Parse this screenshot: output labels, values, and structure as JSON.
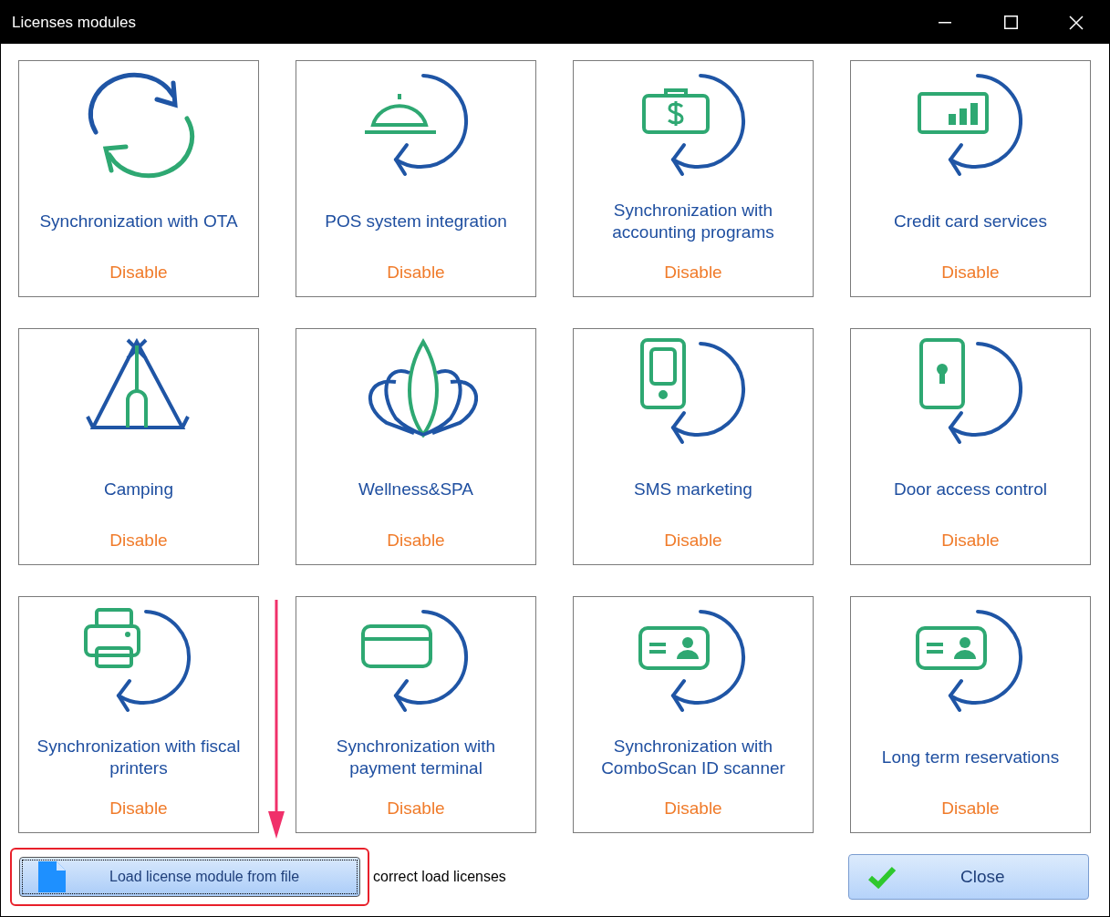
{
  "window": {
    "title": "Licenses modules"
  },
  "modules": [
    {
      "kind": "sync",
      "name": "Synchronization with OTA",
      "status": "Disable"
    },
    {
      "kind": "cloche",
      "name": "POS system integration",
      "status": "Disable"
    },
    {
      "kind": "cash",
      "name": "Synchronization with accounting programs",
      "status": "Disable"
    },
    {
      "kind": "chart",
      "name": "Credit card services",
      "status": "Disable"
    },
    {
      "kind": "tent",
      "name": "Camping",
      "status": "Disable"
    },
    {
      "kind": "lotus",
      "name": "Wellness&SPA",
      "status": "Disable"
    },
    {
      "kind": "phone",
      "name": "SMS marketing",
      "status": "Disable"
    },
    {
      "kind": "door",
      "name": "Door access control",
      "status": "Disable"
    },
    {
      "kind": "printer",
      "name": "Synchronization with fiscal printers",
      "status": "Disable"
    },
    {
      "kind": "card",
      "name": "Synchronization with payment terminal",
      "status": "Disable"
    },
    {
      "kind": "idcard",
      "name": "Synchronization with ComboScan ID scanner",
      "status": "Disable"
    },
    {
      "kind": "idcard",
      "name": "Long term reservations",
      "status": "Disable"
    }
  ],
  "load_button": {
    "label": "Load license module from file"
  },
  "load_status": "correct load licenses",
  "close_button": {
    "label": "Close"
  }
}
